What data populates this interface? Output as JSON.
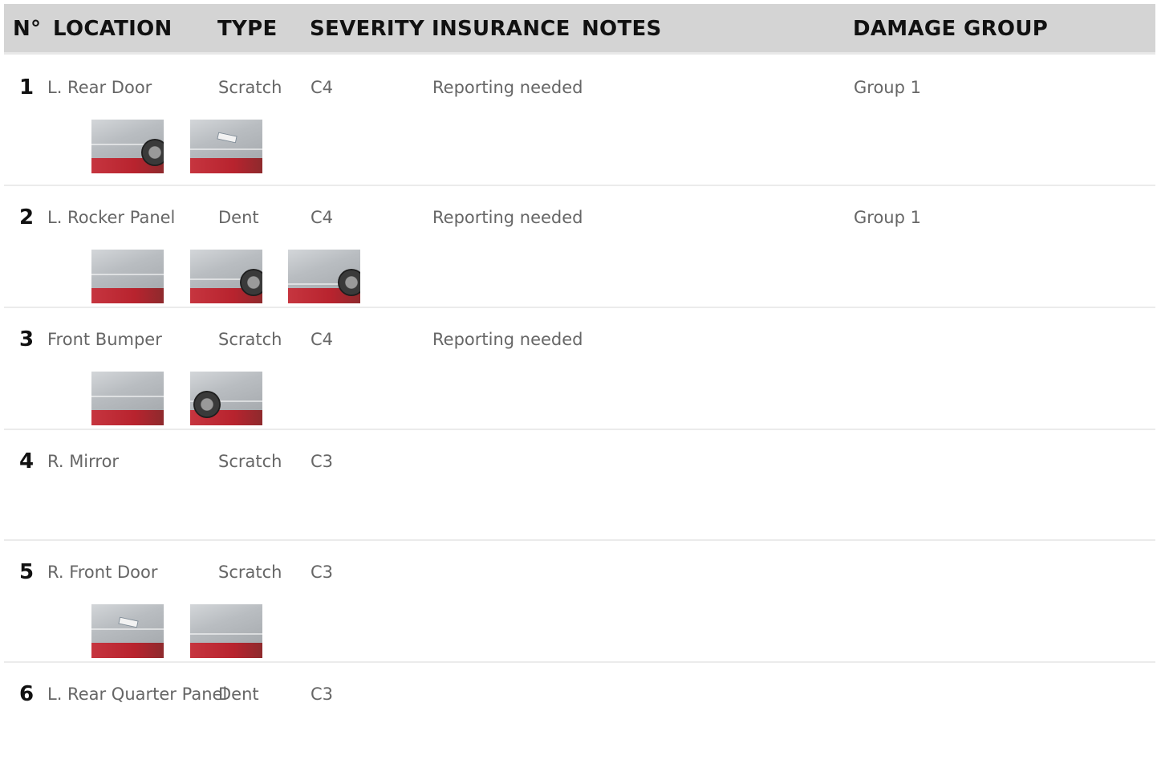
{
  "header": {
    "num": "N°",
    "location": "LOCATION",
    "type": "TYPE",
    "severity": "SEVERITY",
    "insurance": "INSURANCE",
    "notes": "NOTES",
    "damage_group": "DAMAGE GROUP"
  },
  "rows": [
    {
      "num": "1",
      "location": "L. Rear Door",
      "type": "Scratch",
      "severity": "C4",
      "insurance": "Reporting needed",
      "notes": "",
      "damage_group": "Group 1",
      "photos": [
        "door-photo",
        "door-tag-photo"
      ]
    },
    {
      "num": "2",
      "location": "L. Rocker Panel",
      "type": "Dent",
      "severity": "C4",
      "insurance": "Reporting needed",
      "notes": "",
      "damage_group": "Group 1",
      "photos": [
        "rocker-photo",
        "rocker-wheel-photo",
        "rocker-side-photo"
      ]
    },
    {
      "num": "3",
      "location": "Front Bumper",
      "type": "Scratch",
      "severity": "C4",
      "insurance": "Reporting needed",
      "notes": "",
      "damage_group": "",
      "photos": [
        "bumper-photo",
        "front-grille-photo"
      ]
    },
    {
      "num": "4",
      "location": "R. Mirror",
      "type": "Scratch",
      "severity": "C3",
      "insurance": "",
      "notes": "",
      "damage_group": "",
      "photos": []
    },
    {
      "num": "5",
      "location": "R. Front Door",
      "type": "Scratch",
      "severity": "C3",
      "insurance": "",
      "notes": "",
      "damage_group": "",
      "photos": [
        "door-tag-photo",
        "door-sill-photo"
      ]
    },
    {
      "num": "6",
      "location": "L. Rear Quarter Panel",
      "type": "Dent",
      "severity": "C3",
      "insurance": "",
      "notes": "",
      "damage_group": "",
      "photos": []
    }
  ]
}
